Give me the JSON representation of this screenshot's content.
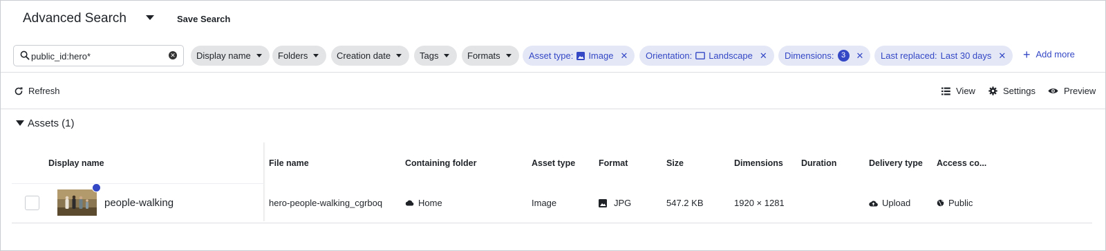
{
  "header": {
    "title": "Advanced Search",
    "save_search_label": "Save Search"
  },
  "search": {
    "value": "public_id:hero*",
    "placeholder": "Search",
    "icon": "search-icon",
    "clear_icon": "clear-icon"
  },
  "filters": {
    "dropdowns": [
      "Display name",
      "Folders",
      "Creation date",
      "Tags",
      "Formats"
    ],
    "active": [
      {
        "label": "Asset type:",
        "value": "Image",
        "icon": "image-icon"
      },
      {
        "label": "Orientation:",
        "value": "Landscape",
        "icon": "landscape-icon"
      },
      {
        "label": "Dimensions:",
        "value": "3",
        "icon": "count-badge"
      },
      {
        "label": "Last replaced:",
        "value": "Last 30 days",
        "icon": ""
      }
    ],
    "add_more_label": "Add more"
  },
  "toolbar": {
    "refresh_label": "Refresh",
    "view_label": "View",
    "settings_label": "Settings",
    "preview_label": "Preview"
  },
  "assets": {
    "section_title": "Assets (1)",
    "columns": [
      "Display name",
      "File name",
      "Containing folder",
      "Asset type",
      "Format",
      "Size",
      "Dimensions",
      "Duration",
      "Delivery type",
      "Access co..."
    ],
    "rows": [
      {
        "display_name": "people-walking",
        "file_name": "hero-people-walking_cgrboq",
        "containing_folder": "Home",
        "asset_type": "Image",
        "format": "JPG",
        "size": "547.2 KB",
        "dimensions": "1920 × 1281",
        "duration": "",
        "delivery_type": "Upload",
        "access_control": "Public"
      }
    ]
  },
  "colors": {
    "accent": "#3448c5",
    "active_chip_bg": "#e4e7f6",
    "chip_bg": "#e3e4e6"
  }
}
